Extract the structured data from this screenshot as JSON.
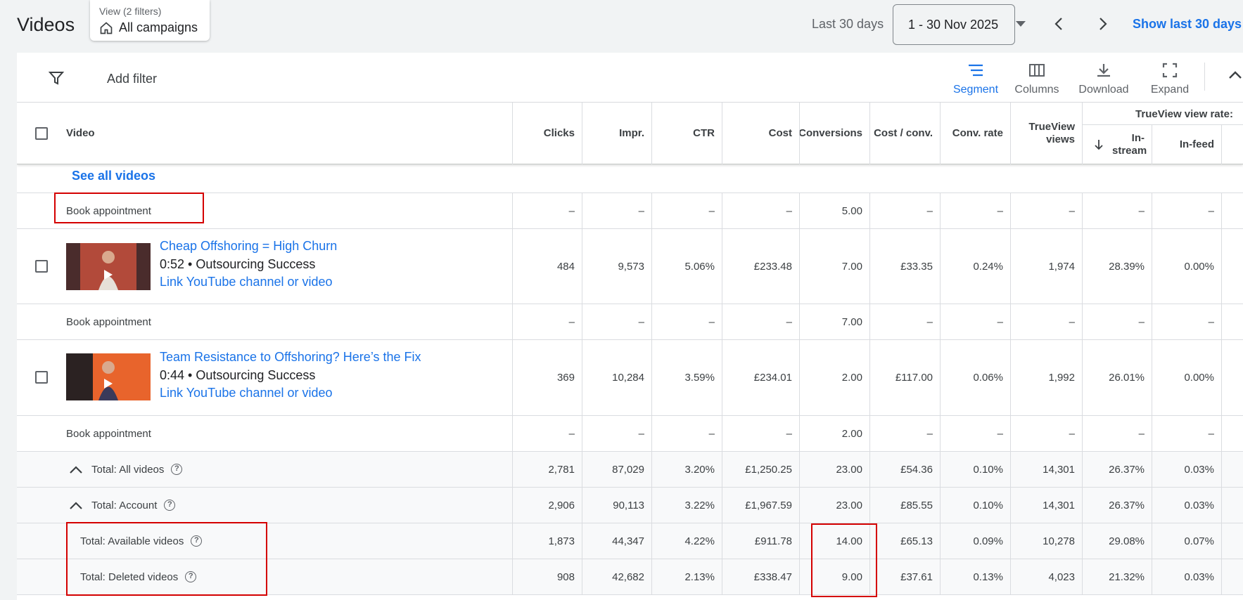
{
  "header": {
    "title": "Videos",
    "view_label": "View (2 filters)",
    "view_value": "All campaigns",
    "range_label": "Last 30 days",
    "date_range": "1 - 30 Nov 2025",
    "show_last": "Show last 30 days"
  },
  "toolbar": {
    "add_filter": "Add filter",
    "segment": "Segment",
    "columns": "Columns",
    "download": "Download",
    "expand": "Expand"
  },
  "table": {
    "headers": {
      "video": "Video",
      "clicks": "Clicks",
      "impr": "Impr.",
      "ctr": "CTR",
      "cost": "Cost",
      "conversions": "Conversions",
      "cost_conv": "Cost / conv.",
      "conv_rate": "Conv. rate",
      "trueview_views": "TrueView views",
      "group": "TrueView view rate:",
      "instream": "In-stream",
      "infeed": "In-feed"
    },
    "see_all": "See all videos",
    "rows": [
      {
        "label": "Book appointment",
        "values": [
          "–",
          "–",
          "–",
          "–",
          "5.00",
          "–",
          "–",
          "–",
          "–",
          "–"
        ]
      },
      {
        "video_title": "Cheap Offshoring = High Churn",
        "duration": "0:52",
        "channel": "Outsourcing Success",
        "link": "Link YouTube channel or video",
        "values": [
          "484",
          "9,573",
          "5.06%",
          "£233.48",
          "7.00",
          "£33.35",
          "0.24%",
          "1,974",
          "28.39%",
          "0.00%"
        ]
      },
      {
        "label": "Book appointment",
        "values": [
          "–",
          "–",
          "–",
          "–",
          "7.00",
          "–",
          "–",
          "–",
          "–",
          "–"
        ]
      },
      {
        "video_title": "Team Resistance to Offshoring? Here’s the Fix",
        "duration": "0:44",
        "channel": "Outsourcing Success",
        "link": "Link YouTube channel or video",
        "values": [
          "369",
          "10,284",
          "3.59%",
          "£234.01",
          "2.00",
          "£117.00",
          "0.06%",
          "1,992",
          "26.01%",
          "0.00%"
        ]
      },
      {
        "label": "Book appointment",
        "values": [
          "–",
          "–",
          "–",
          "–",
          "2.00",
          "–",
          "–",
          "–",
          "–",
          "–"
        ]
      },
      {
        "label": "Total: All videos",
        "values": [
          "2,781",
          "87,029",
          "3.20%",
          "£1,250.25",
          "23.00",
          "£54.36",
          "0.10%",
          "14,301",
          "26.37%",
          "0.03%"
        ]
      },
      {
        "label": "Total: Account",
        "values": [
          "2,906",
          "90,113",
          "3.22%",
          "£1,967.59",
          "23.00",
          "£85.55",
          "0.10%",
          "14,301",
          "26.37%",
          "0.03%"
        ]
      },
      {
        "label": "Total: Available videos",
        "values": [
          "1,873",
          "44,347",
          "4.22%",
          "£911.78",
          "14.00",
          "£65.13",
          "0.09%",
          "10,278",
          "29.08%",
          "0.07%"
        ]
      },
      {
        "label": "Total: Deleted videos",
        "values": [
          "908",
          "42,682",
          "2.13%",
          "£338.47",
          "9.00",
          "£37.61",
          "0.13%",
          "4,023",
          "21.32%",
          "0.03%"
        ]
      }
    ]
  },
  "colors": {
    "accent": "#1a73e8",
    "highlight": "#d40000"
  }
}
